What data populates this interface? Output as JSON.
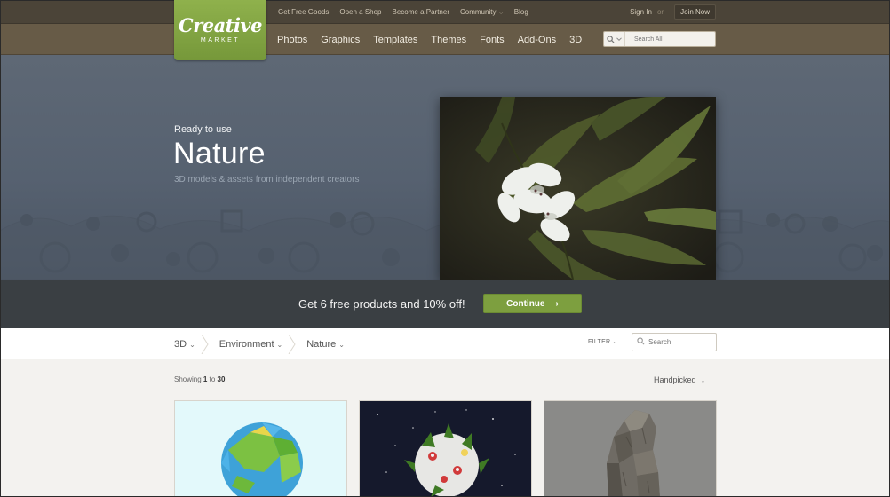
{
  "brand": {
    "logo_top": "Creative",
    "logo_bottom": "MARKET"
  },
  "top_links": [
    "Get Free Goods",
    "Open a Shop",
    "Become a Partner",
    "Community",
    "Blog"
  ],
  "auth": {
    "sign_in": "Sign In",
    "or": "or",
    "join": "Join Now"
  },
  "nav": [
    "Photos",
    "Graphics",
    "Templates",
    "Themes",
    "Fonts",
    "Add-Ons",
    "3D"
  ],
  "search_all": {
    "placeholder": "Search All"
  },
  "hero": {
    "kicker": "Ready to use",
    "title": "Nature",
    "subtitle": "3D models & assets from independent creators"
  },
  "promo": {
    "text": "Get 6 free products and 10% off!",
    "button": "Continue",
    "button_arrow": "›"
  },
  "breadcrumbs": [
    "3D",
    "Environment",
    "Nature"
  ],
  "filter": {
    "label": "FILTER",
    "search_placeholder": "Search"
  },
  "listing": {
    "showing_prefix": "Showing",
    "from": "1",
    "to_word": "to",
    "to": "30",
    "sort": "Handpicked"
  },
  "colors": {
    "brand_green": "#7d9f3f",
    "header_dark": "#4b4438",
    "header_nav": "#675b47",
    "hero": "#566170",
    "promo_bg": "#3a3f43"
  },
  "icons": [
    "search-icon",
    "chevron-down-icon",
    "chevron-right-icon",
    "breadcrumb-separator-icon"
  ]
}
